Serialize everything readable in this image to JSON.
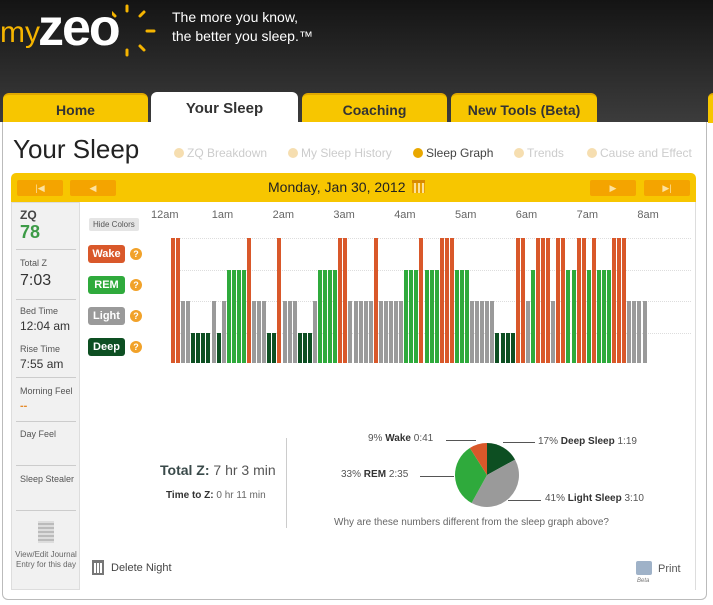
{
  "header": {
    "logo_my": "my",
    "logo_zeo": "zeo",
    "tagline1": "The more you know,",
    "tagline2": "the better you sleep.™"
  },
  "tabs": [
    {
      "label": "Home"
    },
    {
      "label": "Your Sleep",
      "active": true
    },
    {
      "label": "Coaching"
    },
    {
      "label": "New Tools (Beta)"
    }
  ],
  "page_title": "Your Sleep",
  "subnav": [
    {
      "label": "ZQ Breakdown"
    },
    {
      "label": "My Sleep History"
    },
    {
      "label": "Sleep Graph",
      "active": true
    },
    {
      "label": "Trends"
    },
    {
      "label": "Cause and Effect"
    }
  ],
  "date": "Monday, Jan 30, 2012",
  "sidebar": {
    "zq_label": "ZQ",
    "zq": "78",
    "total_label": "Total Z",
    "total": "7:03",
    "bed_label": "Bed Time",
    "bed": "12:04 am",
    "rise_label": "Rise Time",
    "rise": "7:55 am",
    "morning_label": "Morning Feel",
    "morning": "--",
    "day_label": "Day Feel",
    "stealer_label": "Sleep Stealer",
    "journal": "View/Edit Journal Entry for this day"
  },
  "graph": {
    "hide_colors": "Hide Colors",
    "hours": [
      "12am",
      "1am",
      "2am",
      "3am",
      "4am",
      "5am",
      "6am",
      "7am",
      "8am"
    ],
    "stages": [
      {
        "label": "Wake",
        "color": "#d9582a"
      },
      {
        "label": "REM",
        "color": "#2faa3c"
      },
      {
        "label": "Light",
        "color": "#9a9a9a"
      },
      {
        "label": "Deep",
        "color": "#0d4f22"
      }
    ]
  },
  "chart_data": {
    "type": "bar",
    "epoch_minutes": 5,
    "start": "12:04 am",
    "hypnogram": "WWLLDDDDLDLRRRRWLLLDDWLLLDDDLRRRRWWLLLLLWLLLLLRRRWRRRWWWRRRLLLLLDDDDWWLRWWWLWWRRWWRWRRRWWWLLLL",
    "legend_codes": {
      "W": "Wake",
      "R": "REM",
      "L": "Light",
      "D": "Deep"
    }
  },
  "summary": {
    "total_label": "Total Z:",
    "total": "7 hr 3 min",
    "ttz_label": "Time to Z:",
    "ttz": "0 hr 11 min",
    "pie": [
      {
        "pct": "17%",
        "name": "Deep Sleep",
        "time": "1:19",
        "value": 17,
        "color": "#0d4f22"
      },
      {
        "pct": "41%",
        "name": "Light Sleep",
        "time": "3:10",
        "value": 41,
        "color": "#9a9a9a"
      },
      {
        "pct": "33%",
        "name": "REM",
        "time": "2:35",
        "value": 33,
        "color": "#2faa3c"
      },
      {
        "pct": "9%",
        "name": "Wake",
        "time": "0:41",
        "value": 9,
        "color": "#d9582a"
      }
    ],
    "why": "Why are these numbers different from the sleep graph above?"
  },
  "actions": {
    "delete": "Delete Night",
    "print": "Print",
    "print_beta": "Beta"
  }
}
